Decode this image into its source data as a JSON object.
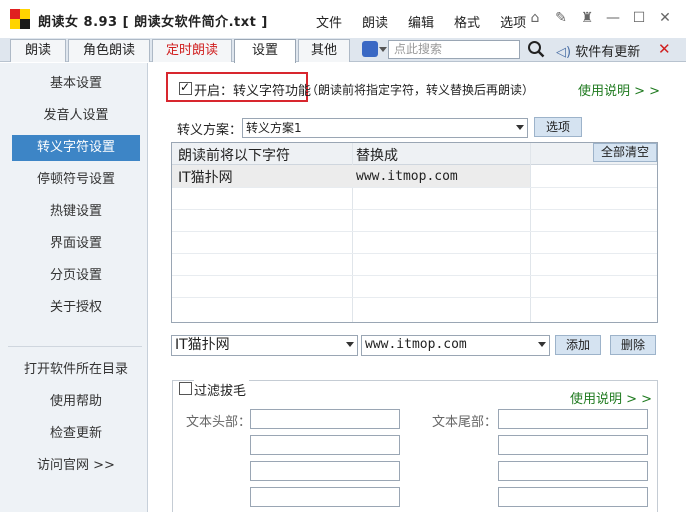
{
  "title": "朗读女 8.93 [ 朗读女软件简介.txt ]",
  "menu": [
    "文件",
    "朗读",
    "编辑",
    "格式",
    "选项"
  ],
  "tabs": [
    "朗读",
    "角色朗读",
    "定时朗读",
    "设置",
    "其他"
  ],
  "search": {
    "placeholder": "点此搜索"
  },
  "update_label": "软件有更新",
  "sidebar": {
    "items": [
      "基本设置",
      "发音人设置",
      "转义字符设置",
      "停顿符号设置",
      "热键设置",
      "界面设置",
      "分页设置",
      "关于授权"
    ],
    "bottom": [
      "打开软件所在目录",
      "使用帮助",
      "检查更新",
      "访问官网 >>"
    ]
  },
  "escape": {
    "enable_label": "开启：转义字符功能",
    "enable_checked": true,
    "hint": "（朗读前将指定字符，转义替换后再朗读）",
    "help_link": "使用说明 > >",
    "scheme_label": "转义方案：",
    "scheme_value": "转义方案1",
    "options_btn": "选项",
    "table": {
      "col1": "朗读前将以下字符",
      "col2": "替换成",
      "clear_btn": "全部清空",
      "rows": [
        {
          "from": "IT猫扑网",
          "to": "www.itmop.com"
        }
      ]
    },
    "input_from": "IT猫扑网",
    "input_to": "www.itmop.com",
    "add_btn": "添加",
    "del_btn": "删除"
  },
  "filter": {
    "label": "过滤拔毛",
    "help_link": "使用说明 > >",
    "head_label": "文本头部：",
    "tail_label": "文本尾部："
  }
}
